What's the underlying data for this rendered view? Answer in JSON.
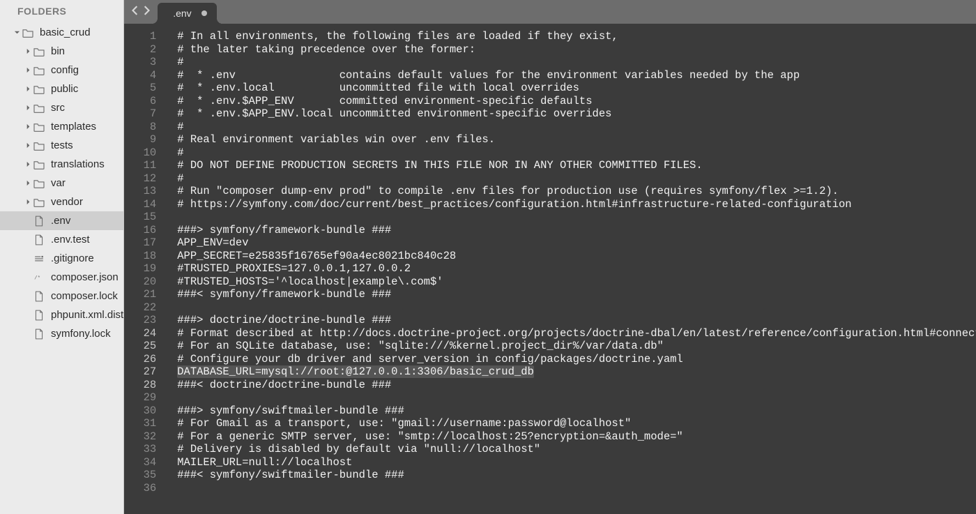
{
  "sidebar": {
    "header": "FOLDERS",
    "tree": [
      {
        "depth": 0,
        "name": "basic_crud",
        "kind": "folder",
        "expanded": true
      },
      {
        "depth": 1,
        "name": "bin",
        "kind": "folder",
        "expanded": false
      },
      {
        "depth": 1,
        "name": "config",
        "kind": "folder",
        "expanded": false
      },
      {
        "depth": 1,
        "name": "public",
        "kind": "folder",
        "expanded": false
      },
      {
        "depth": 1,
        "name": "src",
        "kind": "folder",
        "expanded": false
      },
      {
        "depth": 1,
        "name": "templates",
        "kind": "folder",
        "expanded": false
      },
      {
        "depth": 1,
        "name": "tests",
        "kind": "folder",
        "expanded": false
      },
      {
        "depth": 1,
        "name": "translations",
        "kind": "folder",
        "expanded": false
      },
      {
        "depth": 1,
        "name": "var",
        "kind": "folder",
        "expanded": false
      },
      {
        "depth": 1,
        "name": "vendor",
        "kind": "folder",
        "expanded": false
      },
      {
        "depth": 1,
        "name": ".env",
        "kind": "file",
        "icon": "file",
        "selected": true
      },
      {
        "depth": 1,
        "name": ".env.test",
        "kind": "file",
        "icon": "file"
      },
      {
        "depth": 1,
        "name": ".gitignore",
        "kind": "file",
        "icon": "gitignore"
      },
      {
        "depth": 1,
        "name": "composer.json",
        "kind": "file",
        "icon": "json"
      },
      {
        "depth": 1,
        "name": "composer.lock",
        "kind": "file",
        "icon": "file"
      },
      {
        "depth": 1,
        "name": "phpunit.xml.dist",
        "kind": "file",
        "icon": "file"
      },
      {
        "depth": 1,
        "name": "symfony.lock",
        "kind": "file",
        "icon": "file"
      }
    ]
  },
  "tab": {
    "title": ".env",
    "dirty": true
  },
  "highlighted_line": 27,
  "code_lines": [
    "# In all environments, the following files are loaded if they exist,",
    "# the later taking precedence over the former:",
    "#",
    "#  * .env                contains default values for the environment variables needed by the app",
    "#  * .env.local          uncommitted file with local overrides",
    "#  * .env.$APP_ENV       committed environment-specific defaults",
    "#  * .env.$APP_ENV.local uncommitted environment-specific overrides",
    "#",
    "# Real environment variables win over .env files.",
    "#",
    "# DO NOT DEFINE PRODUCTION SECRETS IN THIS FILE NOR IN ANY OTHER COMMITTED FILES.",
    "#",
    "# Run \"composer dump-env prod\" to compile .env files for production use (requires symfony/flex >=1.2).",
    "# https://symfony.com/doc/current/best_practices/configuration.html#infrastructure-related-configuration",
    "",
    "###> symfony/framework-bundle ###",
    "APP_ENV=dev",
    "APP_SECRET=e25835f16765ef90a4ec8021bc840c28",
    "#TRUSTED_PROXIES=127.0.0.1,127.0.0.2",
    "#TRUSTED_HOSTS='^localhost|example\\.com$'",
    "###< symfony/framework-bundle ###",
    "",
    "###> doctrine/doctrine-bundle ###",
    "# Format described at http://docs.doctrine-project.org/projects/doctrine-dbal/en/latest/reference/configuration.html#connecting-using-a-url",
    "# For an SQLite database, use: \"sqlite:///%kernel.project_dir%/var/data.db\"",
    "# Configure your db driver and server_version in config/packages/doctrine.yaml",
    "DATABASE_URL=mysql://root:@127.0.0.1:3306/basic_crud_db",
    "###< doctrine/doctrine-bundle ###",
    "",
    "###> symfony/swiftmailer-bundle ###",
    "# For Gmail as a transport, use: \"gmail://username:password@localhost\"",
    "# For a generic SMTP server, use: \"smtp://localhost:25?encryption=&auth_mode=\"",
    "# Delivery is disabled by default via \"null://localhost\"",
    "MAILER_URL=null://localhost",
    "###< symfony/swiftmailer-bundle ###",
    ""
  ]
}
